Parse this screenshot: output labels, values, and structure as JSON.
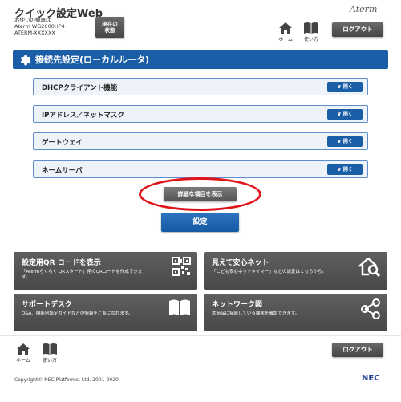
{
  "header": {
    "app_title": "クイック設定Web",
    "device_label": "お使いの機器は",
    "device_model": "Aterm WG2600HP4",
    "device_serial": "ATERM-XXXXXX",
    "status_button_line1": "現在の",
    "status_button_line2": "状態",
    "brand": "Aterm",
    "home_label": "ホーム",
    "manual_label": "使い方",
    "logout_label": "ログアウト"
  },
  "panel": {
    "title": "接続先設定(ローカルルータ)",
    "open_label": "開く",
    "items": [
      {
        "label": "DHCPクライアント機能"
      },
      {
        "label": "IPアドレス／ネットマスク"
      },
      {
        "label": "ゲートウェイ"
      },
      {
        "label": "ネームサーバ"
      }
    ],
    "detail_button": "詳細な項目を表示",
    "submit_button": "設定"
  },
  "tiles": [
    {
      "title": "設定用QR コードを表示",
      "desc": "「Atermらくらく QRスタート」用のQRコードを作成できま",
      "desc2": "す。",
      "icon": "qr-code-icon"
    },
    {
      "title": "見えて安心ネット",
      "desc": "「こども安心ネットタイマー」などの設定はこちらから。",
      "desc2": "",
      "icon": "home-search-icon"
    },
    {
      "title": "サポートデスク",
      "desc": "Q&A、機能別設定ガイドなどの情報をご覧になれます。",
      "desc2": "",
      "icon": "book-icon"
    },
    {
      "title": "ネットワーク図",
      "desc": "本商品に接続している端末を確認できます。",
      "desc2": "",
      "icon": "network-icon"
    }
  ],
  "footer": {
    "home_label": "ホーム",
    "manual_label": "使い方",
    "logout_label": "ログアウト",
    "copyright": "Copyright© NEC Platforms, Ltd. 2001-2020",
    "nec": "NEC"
  },
  "colors": {
    "accent": "#1a5ea8",
    "highlight": "#e0141c",
    "tile_bg": "#555555"
  }
}
